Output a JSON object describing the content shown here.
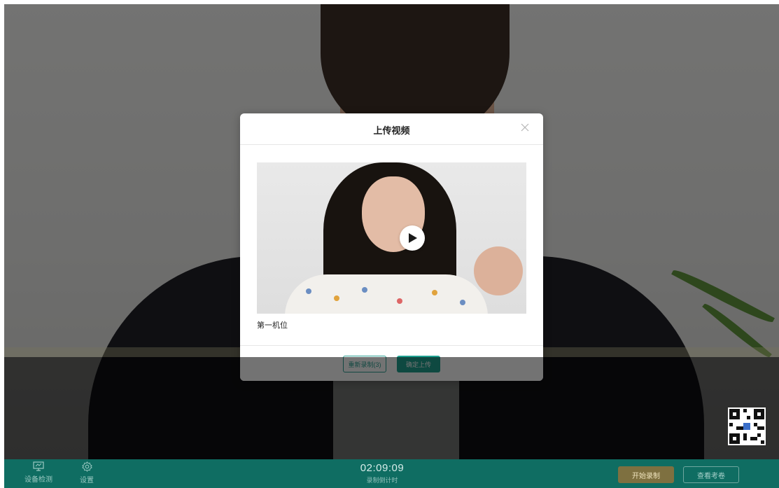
{
  "modal": {
    "title": "上传视频",
    "camera_label": "第一机位",
    "rerecord_label": "重新录制(3)",
    "confirm_label": "确定上传"
  },
  "toolbar": {
    "device_check_label": "设备检测",
    "settings_label": "设置",
    "timer_value": "02:09:09",
    "timer_label": "录制倒计时",
    "start_label": "开始录制",
    "view_exam_label": "查看考卷"
  },
  "icons": {
    "close": "close-icon",
    "play": "play-icon",
    "device_check": "monitor-icon",
    "settings": "gear-icon",
    "qr": "qr-code-icon"
  },
  "colors": {
    "toolbar_bg": "#0f6d62",
    "accent": "#1fa291",
    "start_button": "#7e7040"
  }
}
